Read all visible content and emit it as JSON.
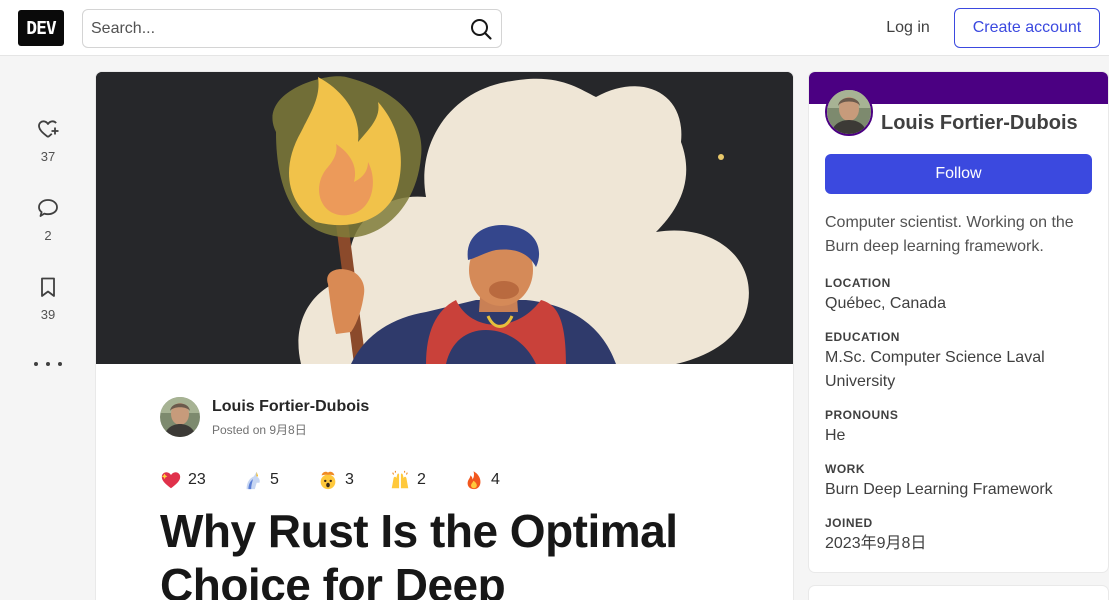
{
  "header": {
    "logo": "DEV",
    "search_placeholder": "Search...",
    "login_label": "Log in",
    "create_label": "Create account"
  },
  "rail": {
    "hearts": "37",
    "comments": "2",
    "bookmarks": "39"
  },
  "article": {
    "author": "Louis Fortier-Dubois",
    "posted": "Posted on 9月8日",
    "reactions": [
      {
        "icon": "sparkle-heart-emoji",
        "count": "23"
      },
      {
        "icon": "unicorn-emoji",
        "count": "5"
      },
      {
        "icon": "exploding-head-emoji",
        "count": "3"
      },
      {
        "icon": "raised-hands-emoji",
        "count": "2"
      },
      {
        "icon": "fire-emoji",
        "count": "4"
      }
    ],
    "title_line1": "Why Rust Is the Optimal",
    "title_line2": "Choice for Deep"
  },
  "profile": {
    "name": "Louis Fortier-Dubois",
    "follow_label": "Follow",
    "bio": "Computer scientist. Working on the Burn deep learning framework.",
    "fields": [
      {
        "label": "LOCATION",
        "value": "Québec, Canada"
      },
      {
        "label": "EDUCATION",
        "value": "M.Sc. Computer Science Laval University"
      },
      {
        "label": "PRONOUNS",
        "value": "He"
      },
      {
        "label": "WORK",
        "value": "Burn Deep Learning Framework"
      },
      {
        "label": "JOINED",
        "value": "2023年9月8日"
      }
    ]
  },
  "colors": {
    "accent": "#3b49df",
    "brand_band": "#4b0082"
  }
}
